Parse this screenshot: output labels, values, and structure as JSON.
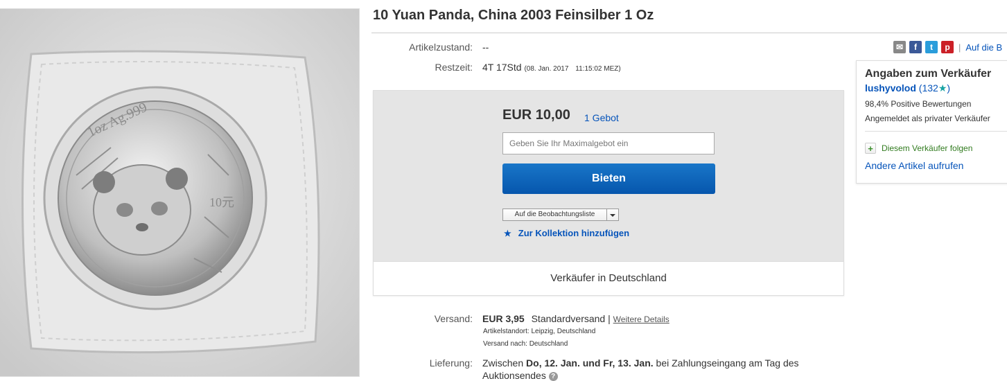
{
  "title": "10 Yuan Panda, China 2003 Feinsilber 1 Oz",
  "condition": {
    "label": "Artikelzustand:",
    "value": "--"
  },
  "time_left": {
    "label": "Restzeit:",
    "value": "4T 17Std",
    "end_date": "(08. Jan. 2017",
    "end_time": "11:15:02 MEZ)"
  },
  "bid_box": {
    "price": "EUR 10,00",
    "bids": "1 Gebot",
    "max_bid_placeholder": "Geben Sie Ihr Maximalgebot ein",
    "bid_button": "Bieten",
    "watchlist_label": "Auf die Beobachtungsliste",
    "collection_label": "Zur Kollektion hinzufügen",
    "seller_location": "Verkäufer in Deutschland"
  },
  "shipping": {
    "label": "Versand:",
    "price": "EUR 3,95",
    "method": "Standardversand",
    "separator": "|",
    "details_link": "Weitere Details",
    "item_location": "Artikelstandort:  Leipzig, Deutschland",
    "ships_to": "Versand nach:  Deutschland"
  },
  "delivery": {
    "label": "Lieferung:",
    "prefix": "Zwischen",
    "range": "Do, 12. Jan. und Fr, 13. Jan.",
    "suffix": "bei Zahlungseingang am Tag des",
    "line2": "Auktionsendes"
  },
  "share": {
    "separator": "|",
    "watch_link": "Auf die B",
    "icons": [
      "email-icon",
      "facebook-icon",
      "twitter-icon",
      "pinterest-icon"
    ]
  },
  "seller": {
    "heading": "Angaben zum Verkäufer",
    "name": "lushyvolod",
    "score": "(132",
    "score_close": ")",
    "star": "★",
    "positive": "98,4% Positive Bewertungen",
    "type": "Angemeldet als privater Verkäufer",
    "follow": "Diesem Verkäufer folgen",
    "other_items": "Andere Artikel aufrufen"
  },
  "coin_image": {
    "inscription_top": "1oz Ag.999",
    "denomination": "10元"
  },
  "colors": {
    "link": "#0654ba",
    "button": "#0654ba",
    "follow_green": "#317b1f",
    "star": "#17a3a3"
  }
}
